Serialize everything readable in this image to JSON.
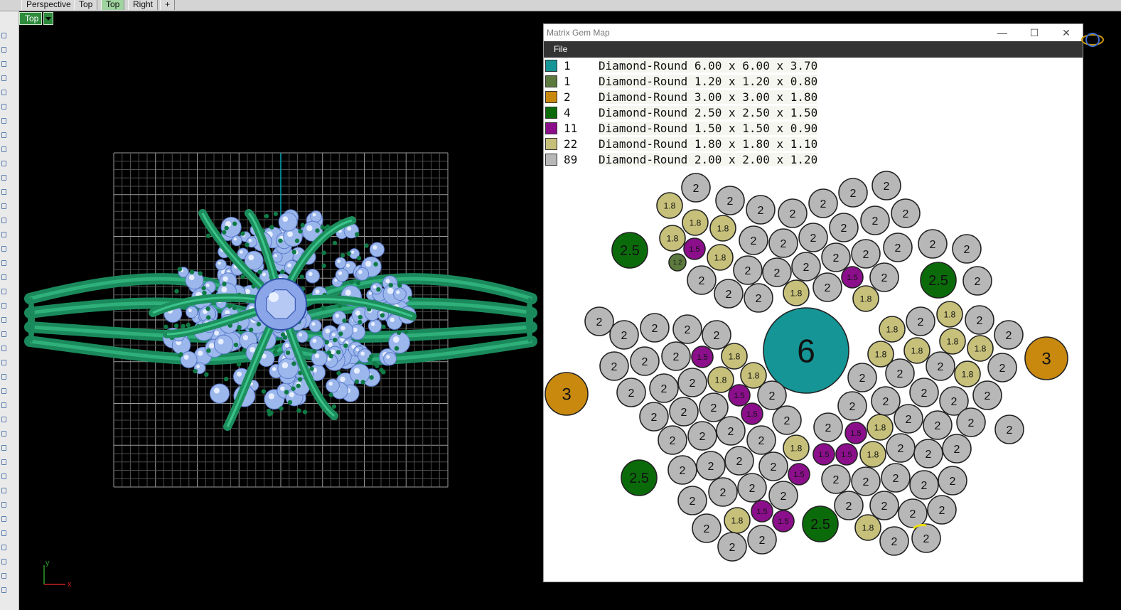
{
  "tabs": [
    {
      "label": "Perspective",
      "active": false
    },
    {
      "label": "Top",
      "active": false
    },
    {
      "label": "Top",
      "active": true
    },
    {
      "label": "Right",
      "active": false
    },
    {
      "label": "+",
      "active": false
    }
  ],
  "viewport": {
    "label": "Top",
    "axis_y": "y",
    "axis_x": "x"
  },
  "gem_window": {
    "title": "Matrix Gem Map",
    "menu": [
      "File"
    ],
    "controls": {
      "minimize": "—",
      "maximize": "☐",
      "close": "✕"
    },
    "legend": [
      {
        "count": "1",
        "desc": "Diamond-Round 6.00 x 6.00 x 3.70",
        "color": "#159595"
      },
      {
        "count": "1",
        "desc": "Diamond-Round 1.20 x 1.20 x 0.80",
        "color": "#5c7a3e"
      },
      {
        "count": "2",
        "desc": "Diamond-Round 3.00 x 3.00 x 1.80",
        "color": "#c9890f"
      },
      {
        "count": "4",
        "desc": "Diamond-Round 2.50 x 2.50 x 1.50",
        "color": "#0b6b0b"
      },
      {
        "count": "11",
        "desc": "Diamond-Round 1.50 x 1.50 x 0.90",
        "color": "#8b0f8b"
      },
      {
        "count": "22",
        "desc": "Diamond-Round 1.80 x 1.80 x 1.10",
        "color": "#c6c07a"
      },
      {
        "count": "89",
        "desc": "Diamond-Round 2.00 x 2.00 x 1.20",
        "color": "#b7b7b7"
      }
    ],
    "labels": {
      "6": "6",
      "3": "3",
      "2.5": "2.5",
      "2": "2",
      "1.8": "1.8",
      "1.5": "1.5",
      "1.2": "1.2"
    }
  }
}
